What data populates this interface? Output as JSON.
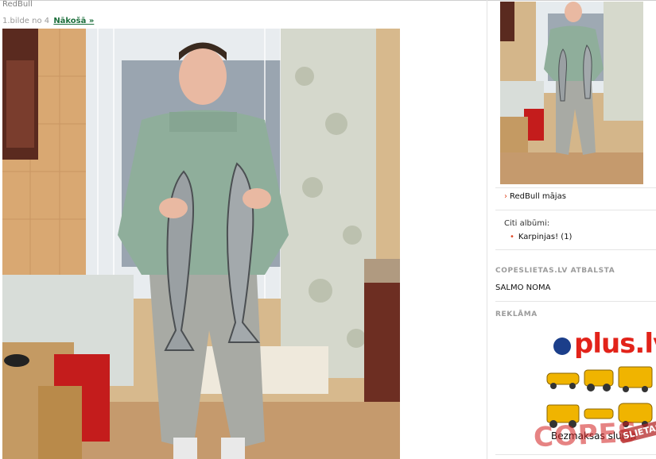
{
  "header": {
    "title": "RedBull",
    "image_counter": "1.bilde no 4",
    "next_link": "Nākošā »"
  },
  "sidebar": {
    "album_link": "RedBull mājas",
    "other_albums_title": "Citi albūmi:",
    "other_albums": [
      {
        "label": "Karpinjas! (1)"
      }
    ],
    "support_heading": "COPESLIETAS.LV ATBALSTA",
    "support_link": "SALMO NOMA",
    "ad_heading": "REKLĀMA",
    "ad": {
      "logo_text": "plus.lv",
      "caption": "Bezmaksas sludin",
      "watermark": "COPES",
      "watermark_sub": "SLIETAS"
    }
  },
  "colors": {
    "link_green": "#1d6f3c",
    "accent_red": "#e04a27",
    "ad_red": "#e2231a",
    "ad_blue": "#1b3e8a"
  }
}
